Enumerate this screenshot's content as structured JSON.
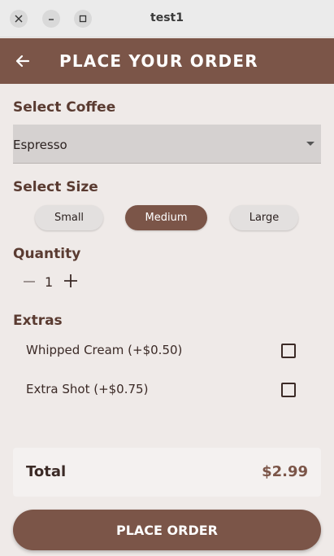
{
  "window": {
    "title": "test1",
    "controls": [
      "close-icon",
      "minimize-icon",
      "maximize-icon"
    ]
  },
  "appbar": {
    "title": "PLACE YOUR ORDER",
    "back_icon": "arrow-left-icon"
  },
  "coffee": {
    "label": "Select Coffee",
    "selected": "Espresso"
  },
  "size": {
    "label": "Select Size",
    "options": [
      "Small",
      "Medium",
      "Large"
    ],
    "selected": "Medium"
  },
  "quantity": {
    "label": "Quantity",
    "value": "1"
  },
  "extras": {
    "label": "Extras",
    "items": [
      {
        "label": "Whipped Cream (+$0.50)",
        "checked": false
      },
      {
        "label": "Extra Shot (+$0.75)",
        "checked": false
      }
    ]
  },
  "total": {
    "label": "Total",
    "value": "$2.99"
  },
  "place_order_label": "PLACE ORDER",
  "colors": {
    "primary": "#7b5548",
    "background": "#efeae8",
    "dropdown_bg": "#d5d1d0",
    "chip_bg": "#e3e0df",
    "text_dark": "#3b2a26"
  }
}
